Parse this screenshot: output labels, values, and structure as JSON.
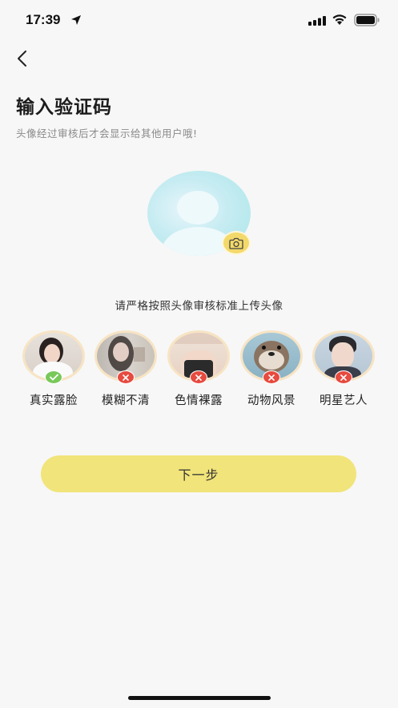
{
  "status": {
    "time": "17:39"
  },
  "header": {
    "title": "输入验证码",
    "subtitle": "头像经过审核后才会显示给其他用户哦!"
  },
  "guide": "请严格按照头像审核标准上传头像",
  "examples": [
    {
      "label": "真实露脸",
      "status": "ok"
    },
    {
      "label": "模糊不清",
      "status": "rejected"
    },
    {
      "label": "色情裸露",
      "status": "rejected"
    },
    {
      "label": "动物风景",
      "status": "rejected"
    },
    {
      "label": "明星艺人",
      "status": "rejected"
    }
  ],
  "next_button": "下一步",
  "colors": {
    "accent": "#f1e47a",
    "ok": "#79c95a",
    "reject": "#e74a3f",
    "avatar_ring": "#f7e4c4"
  }
}
